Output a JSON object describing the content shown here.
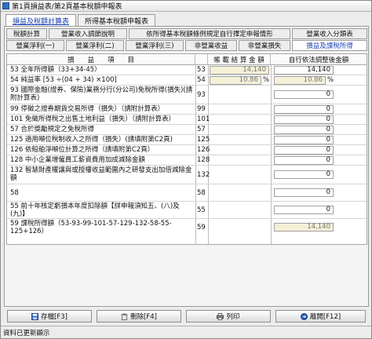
{
  "window": {
    "title": "第1頁損益表/第2頁基本稅額申報表"
  },
  "top_tabs": [
    {
      "label": "損益及稅額計算表",
      "active": true
    },
    {
      "label": "所得基本稅額申報表",
      "active": false
    }
  ],
  "sub_tabs": [
    {
      "label": "稅額計算",
      "active": false
    },
    {
      "label": "營業收入調節說明",
      "active": false
    },
    {
      "label": "依所得基本稅額條例規定自行擇定申報情形",
      "active": false
    },
    {
      "label": "營業收入分類表",
      "active": false
    },
    {
      "label": "營業淨利(一)",
      "active": false
    },
    {
      "label": "營業淨利(二)",
      "active": false
    },
    {
      "label": "營業淨利(三)",
      "active": false
    },
    {
      "label": "非營業收益",
      "active": false
    },
    {
      "label": "非營業損失",
      "active": false
    },
    {
      "label": "損益及課稅所得",
      "active": true
    }
  ],
  "columns": {
    "item": "損　　益　　項　　目",
    "declared": "帳 載 結 算 金 額",
    "adjusted": "自行依法調整後金額"
  },
  "rows": [
    {
      "label": "53 全年所得額（33+34-45）",
      "code": "53",
      "declared": "14,140",
      "adjusted": "14,140",
      "declared_ro": true,
      "adjusted_ro": false
    },
    {
      "label": "54 純益率 [53 ÷(04 + 34) ×100]",
      "code": "54",
      "declared": "10.86",
      "adjusted": "10.86",
      "declared_ro": true,
      "adjusted_ro": true,
      "unit": "%"
    },
    {
      "label": "93 國際金融(證券、保險)業務分行(分公司)免稅所得(損失)(請附計算表)",
      "code": "93",
      "declared": "",
      "adjusted": "0"
    },
    {
      "label": "99 停徵之證券期貨交易所得（損失）（請附計算表）",
      "code": "99",
      "declared": "",
      "adjusted": "0"
    },
    {
      "label": "101 免徵所得稅之出售土地利益（損失）（請附計算表）",
      "code": "101",
      "declared": "",
      "adjusted": "0"
    },
    {
      "label": "57 合於獎勵規定之免稅所得",
      "code": "57",
      "declared": "",
      "adjusted": "0"
    },
    {
      "label": "125 適用噸位稅制收入之所得（損失）(請填附第C2頁)",
      "code": "125",
      "declared": "",
      "adjusted": "0"
    },
    {
      "label": "126 依船舶淨噸位計算之所得（請填附第C2頁）",
      "code": "126",
      "declared": "",
      "adjusted": "0"
    },
    {
      "label": "128 中小企業增僱員工薪資費用加成減除金額",
      "code": "128",
      "declared": "",
      "adjusted": "0"
    },
    {
      "label": "132 智慧財產權讓與或授權收益範圍內之研發支出加倍減除金額",
      "code": "132",
      "declared": "",
      "adjusted": "0"
    },
    {
      "label": "58",
      "code": "58",
      "declared": "",
      "adjusted": "0"
    },
    {
      "label": "55 前十年核定虧損本年度扣除額【詳申報須知五、(八)及(九)】",
      "code": "55",
      "declared": "",
      "adjusted": "0"
    },
    {
      "label": "59 課稅所得額（53-93-99-101-57-129-132-58-55-125+126）",
      "code": "59",
      "declared": "",
      "adjusted": "14,140",
      "adjusted_ro": true
    }
  ],
  "buttons": [
    {
      "label": "存檔[F3]",
      "icon": "save-icon"
    },
    {
      "label": "刪除[F4]",
      "icon": "delete-icon"
    },
    {
      "label": "列印",
      "icon": "print-icon"
    },
    {
      "label": "離開[F12]",
      "icon": "exit-icon"
    }
  ],
  "status": {
    "text": "資料已更新顯示"
  },
  "colors": {
    "readonly_fill": "#f5f0d8",
    "active_tab_text": "#1a3fb0"
  }
}
